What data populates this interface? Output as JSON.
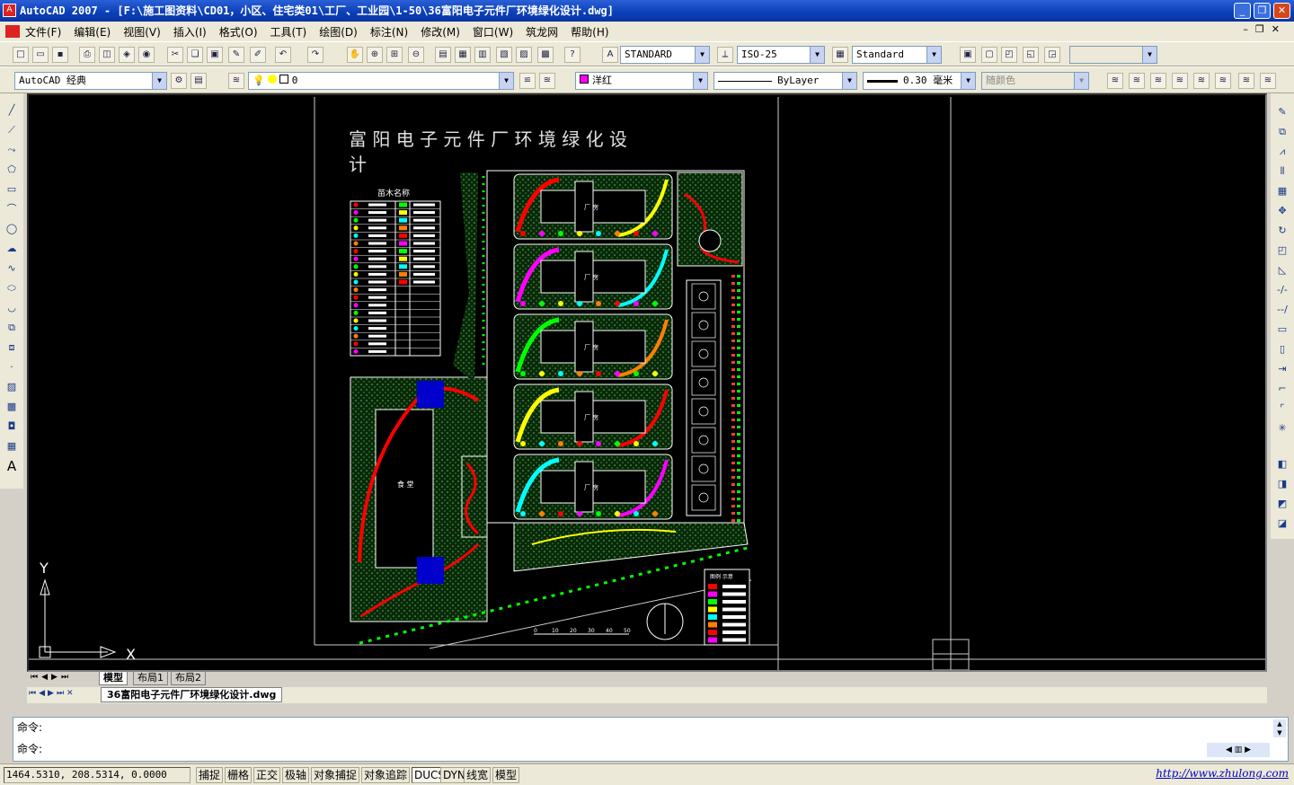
{
  "window": {
    "title": "AutoCAD 2007 - [F:\\施工图资料\\CD01，小区、住宅类01\\工厂、工业园\\1-50\\36富阳电子元件厂环境绿化设计.dwg]",
    "logo": "A"
  },
  "menu": [
    "文件(F)",
    "编辑(E)",
    "视图(V)",
    "插入(I)",
    "格式(O)",
    "工具(T)",
    "绘图(D)",
    "标注(N)",
    "修改(M)",
    "窗口(W)",
    "筑龙网",
    "帮助(H)"
  ],
  "toolbar1": {
    "text_style": "STANDARD",
    "dim_style": "ISO-25",
    "table_style": "Standard"
  },
  "toolbar2": {
    "workspace": "AutoCAD 经典",
    "layer": "0",
    "color": "洋红",
    "linetype": "ByLayer",
    "lineweight": "0.30 毫米",
    "plotstyle": "随颜色"
  },
  "colors": {
    "magenta": "#ff00ff",
    "green": "#00ff00",
    "yellow": "#ffff00",
    "red": "#ff0000",
    "cyan": "#00ffff",
    "orange": "#ff8000"
  },
  "drawing": {
    "title": "富 阳 电 子 元 件 厂 环 境 绿 化 设",
    "title_line2": "计",
    "plant_table_title": "苗木名称",
    "factory_label": "厂 房",
    "canteen_label": "食 堂",
    "legend_title": "图例 示意",
    "scale_labels": [
      "0",
      "10",
      "20",
      "30",
      "40",
      "50"
    ],
    "ucs_x": "X",
    "ucs_y": "Y"
  },
  "tabs": [
    "模型",
    "布局1",
    "布局2"
  ],
  "file_tab": "36富阳电子元件厂环境绿化设计.dwg",
  "command": {
    "line1": "命令:",
    "line2": "命令:"
  },
  "status": {
    "coords": "1464.5310, 208.5314, 0.0000",
    "buttons": [
      "捕捉",
      "栅格",
      "正交",
      "极轴",
      "对象捕捉",
      "对象追踪",
      "DUCS",
      "DYN",
      "线宽",
      "模型"
    ],
    "url": "http://www.zhulong.com"
  }
}
